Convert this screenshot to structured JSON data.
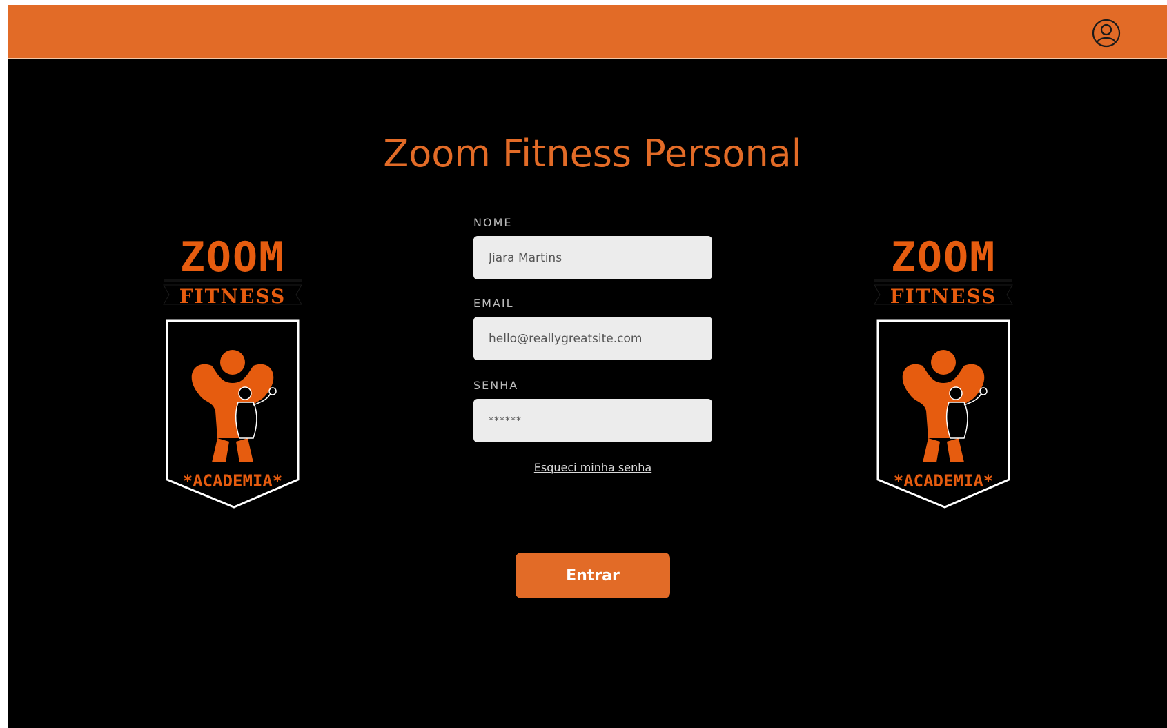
{
  "header": {
    "user_icon": "user-circle-icon",
    "color": "#e26b27"
  },
  "page": {
    "title": "Zoom Fitness Personal"
  },
  "logo": {
    "line1": "ZOOM",
    "line2": "FITNESS",
    "line3": "*ACADEMIA*"
  },
  "form": {
    "name_label": "NOME",
    "name_value": "Jiara Martins",
    "email_label": "EMAIL",
    "email_value": "hello@reallygreatsite.com",
    "password_label": "SENHA",
    "password_value": "******",
    "forgot_link": "Esqueci minha senha",
    "submit_label": "Entrar"
  },
  "colors": {
    "accent": "#e26b27",
    "background": "#000000",
    "input_bg": "#ececec"
  }
}
